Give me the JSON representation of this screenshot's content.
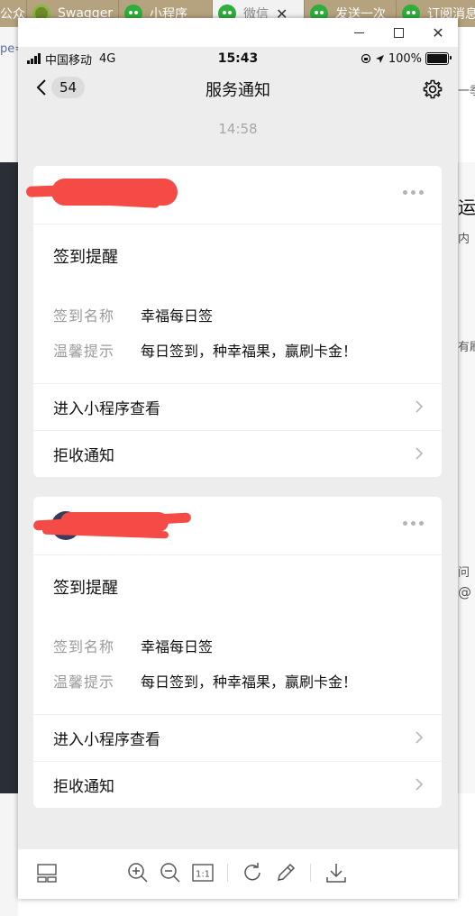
{
  "browser": {
    "tabs": [
      {
        "label": "公众号"
      },
      {
        "label": "Swagger"
      },
      {
        "label": "小程序"
      },
      {
        "label": "微信",
        "active": true
      },
      {
        "label": "发送一次"
      },
      {
        "label": "订阅消息"
      }
    ],
    "background_left_text": "pe=",
    "background_right_texts": [
      "一季",
      "运",
      "内",
      "有刷",
      "问",
      "@"
    ]
  },
  "window": {
    "minimize": "minimize",
    "maximize": "maximize",
    "close": "✕"
  },
  "status_bar": {
    "carrier": "中国移动",
    "network": "4G",
    "time": "15:43",
    "battery_text": "100%",
    "battery_level": 1.0
  },
  "nav": {
    "back_count": "54",
    "title": "服务通知"
  },
  "time_divider": "14:58",
  "cards": [
    {
      "title": "签到提醒",
      "fields": [
        {
          "label": "签到名称",
          "value": "幸福每日签"
        },
        {
          "label": "温馨提示",
          "value": "每日签到，种幸福果，赢刷卡金！"
        }
      ],
      "actions": [
        {
          "label": "进入小程序查看"
        },
        {
          "label": "拒收通知"
        }
      ]
    },
    {
      "title": "签到提醒",
      "fields": [
        {
          "label": "签到名称",
          "value": "幸福每日签"
        },
        {
          "label": "温馨提示",
          "value": "每日签到，种幸福果，赢刷卡金！"
        }
      ],
      "actions": [
        {
          "label": "进入小程序查看"
        },
        {
          "label": "拒收通知"
        }
      ]
    }
  ],
  "toolbar": {
    "icons": [
      "layout-icon",
      "zoom-in-icon",
      "zoom-out-icon",
      "actual-size-icon",
      "rotate-icon",
      "edit-icon",
      "download-icon"
    ],
    "actual_size_label": "1:1"
  },
  "colors": {
    "redaction": "#f44b46",
    "chat_background": "#ededed",
    "tab_bar": "#b5a27e"
  }
}
